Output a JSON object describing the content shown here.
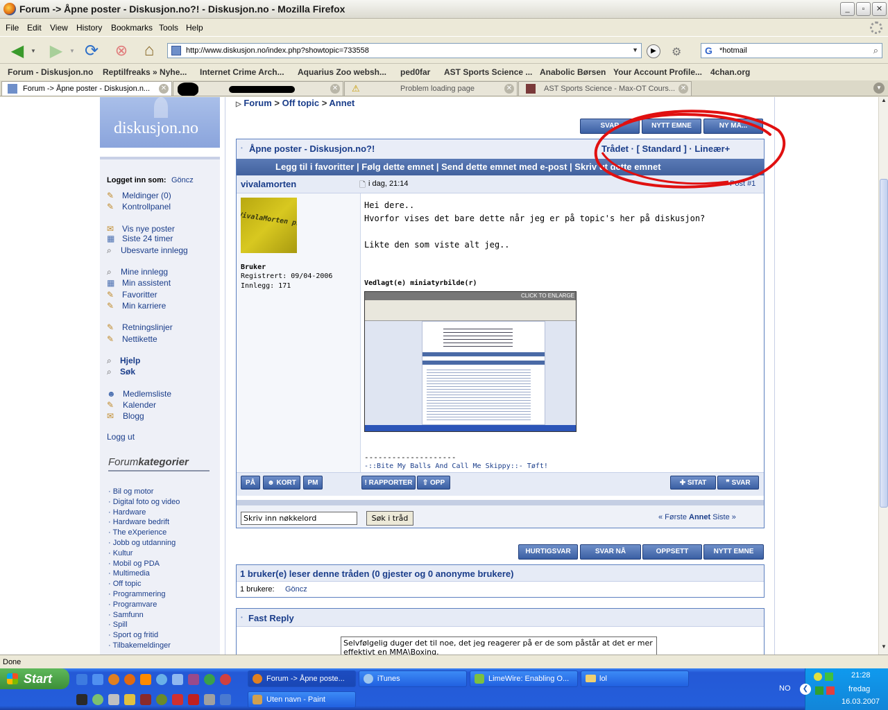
{
  "window": {
    "title": "Forum -> Åpne poster - Diskusjon.no?! - Diskusjon.no - Mozilla Firefox"
  },
  "menu": [
    "File",
    "Edit",
    "View",
    "History",
    "Bookmarks",
    "Tools",
    "Help"
  ],
  "nav": {
    "url": "http://www.diskusjon.no/index.php?showtopic=733558",
    "search_value": "*hotmail"
  },
  "bookmarks": [
    "Forum - Diskusjon.no",
    "Reptilfreaks » Nyhe...",
    "Internet Crime Arch...",
    "Aquarius Zoo websh...",
    "ped0far",
    "AST Sports Science ...",
    "Anabolic Børsen",
    "Your Account Profile...",
    "4chan.org"
  ],
  "tabs": [
    {
      "label": "Forum -> Åpne poster - Diskusjon.n...",
      "active": true
    },
    {
      "label": "",
      "active": false
    },
    {
      "label": "Problem loading page",
      "active": false
    },
    {
      "label": "AST Sports Science - Max-OT Cours...",
      "active": false
    }
  ],
  "status": "Done",
  "site": {
    "logo": "diskusjon.no",
    "breadcrumb": [
      "Forum",
      "Off topic",
      "Annet"
    ],
    "breadcrumb_sep": ">"
  },
  "sidebar": {
    "logged_in_label": "Logget inn som:",
    "user": "Göncz",
    "links1": [
      "Meldinger (0)",
      "Kontrollpanel"
    ],
    "links2": [
      "Vis nye poster",
      "Siste 24 timer",
      "Ubesvarte innlegg"
    ],
    "links3": [
      "Mine innlegg",
      "Min assistent",
      "Favoritter",
      "Min karriere"
    ],
    "links4": [
      "Retningslinjer",
      "Nettikette"
    ],
    "links5": [
      "Hjelp",
      "Søk"
    ],
    "links6": [
      "Medlemsliste",
      "Kalender",
      "Blogg"
    ],
    "logout": "Logg ut",
    "categories_title_a": "Forum",
    "categories_title_b": "kategorier",
    "categories": [
      "Bil og motor",
      "Digital foto og video",
      "Hardware",
      "Hardware bedrift",
      "The eXperience",
      "Jobb og utdanning",
      "Kultur",
      "Mobil og PDA",
      "Multimedia",
      "Off topic",
      "Programmering",
      "Programvare",
      "Samfunn",
      "Spill",
      "Sport og fritid",
      "Tilbakemeldinger"
    ]
  },
  "top_buttons": [
    "SVAR",
    "NYTT EMNE",
    "NY MA..."
  ],
  "topic": {
    "title": "Åpne poster - Diskusjon.no?!",
    "view_modes": "Trådet · [ Standard ] · Lineær+",
    "toolbar": "Legg til i favoritter | Følg dette emnet | Send dette emnet med e-post | Skriv ut dette emnet"
  },
  "post": {
    "author": "vivalamorten",
    "date": "i dag, 21:14",
    "number": "Post #1",
    "avatar_text": "VivalaMorten professional",
    "group": "Bruker",
    "registered": "Registrert: 09/04-2006",
    "posts": "Innlegg: 171",
    "body": [
      "Hei dere..",
      "Hvorfor vises det bare dette når jeg er på topic's her på diskusjon?",
      "",
      "Likte den som viste alt jeg.."
    ],
    "attach_label": "Vedlagt(e) miniatyrbilde(r)",
    "enlarge": "CLICK TO ENLARGE",
    "sig_line": "--------------------",
    "signature": "-::Bite My Balls And Call Me Skippy::- Tøft!",
    "btns_left": [
      "PÅ",
      "KORT",
      "PM"
    ],
    "btns_mid": [
      "RAPPORTER",
      "OPP"
    ],
    "btns_right": [
      "SITAT",
      "SVAR"
    ]
  },
  "thread_search": {
    "placeholder": "Skriv inn nøkkelord",
    "button": "Søk i tråd",
    "pager_first": "« Første",
    "pager_current": "Annet",
    "pager_last": "Siste »"
  },
  "bottom_buttons": [
    "HURTIGSVAR",
    "SVAR NÅ",
    "OPPSETT",
    "NYTT EMNE"
  ],
  "readers": {
    "heading": "1 bruker(e) leser denne tråden (0 gjester og 0 anonyme brukere)",
    "list_label": "1 brukere:",
    "user": "Göncz"
  },
  "fast_reply": {
    "title": "Fast Reply",
    "text": "Selvfølgelig duger det til noe, det jeg reagerer på er de som påstår at det er mer effektivt en MMA\\Boxing."
  },
  "taskbar": {
    "start": "Start",
    "windows": [
      "Forum -> Åpne poste...",
      "iTunes",
      "LimeWire: Enabling O...",
      "lol",
      "Uten navn - Paint"
    ],
    "lang": "NO",
    "time": "21:28",
    "day": "fredag",
    "date": "16.03.2007"
  },
  "colors": {
    "annotation": "#e01010",
    "forum_blue": "#42619e",
    "link": "#1a3d8a"
  }
}
